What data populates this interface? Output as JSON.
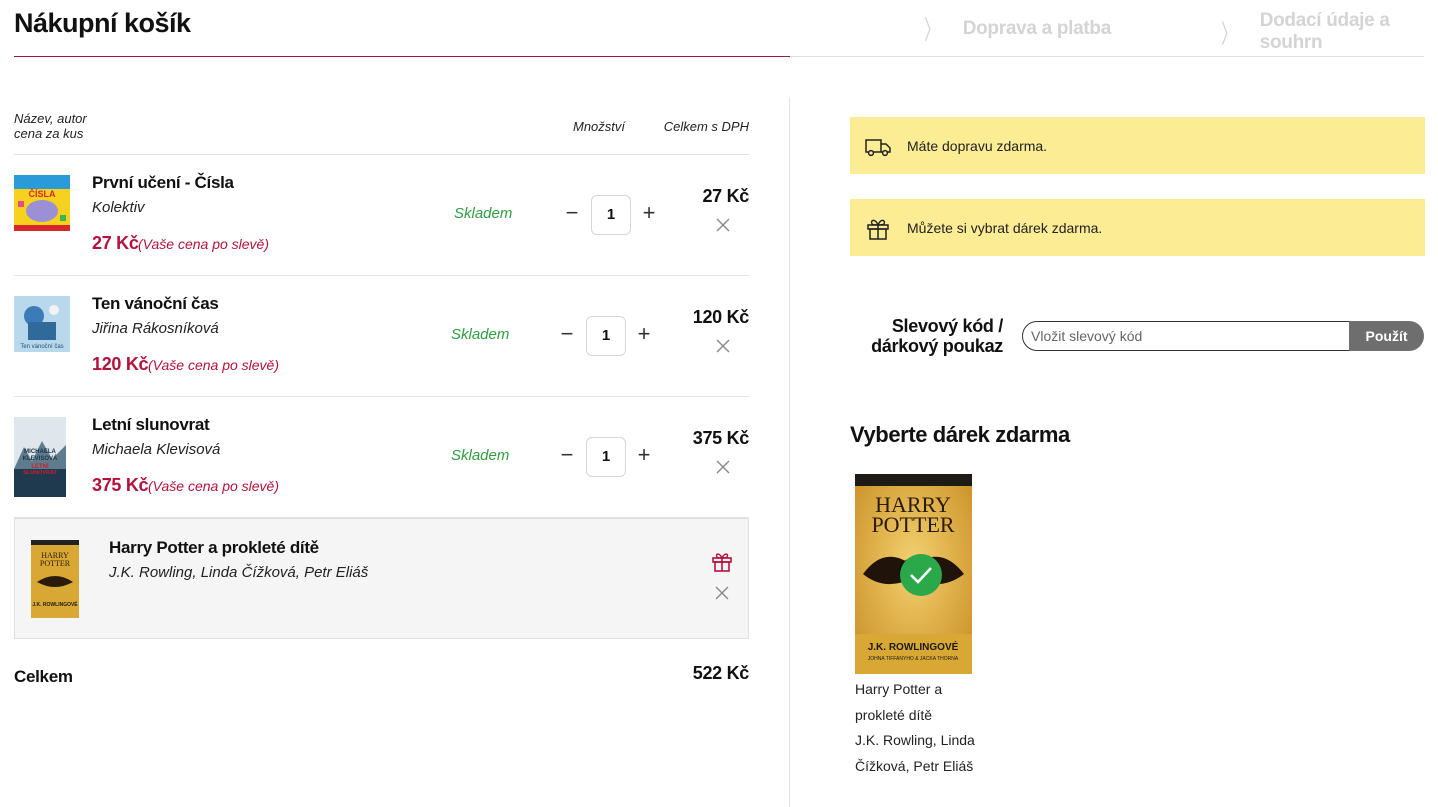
{
  "header": {
    "title": "Nákupní košík",
    "steps": [
      "Doprava a platba",
      "Dodací údaje a souhrn"
    ]
  },
  "cart": {
    "col_name": "Název, autor",
    "col_unit": "cena za kus",
    "col_qty": "Množství",
    "col_total": "Celkem s DPH",
    "items": [
      {
        "title": "První učení - Čísla",
        "author": "Kolektiv",
        "price": "27 Kč",
        "price_note": "(Vaše cena po slevě)",
        "stock": "Skladem",
        "qty": "1",
        "total": "27 Kč"
      },
      {
        "title": "Ten vánoční čas",
        "author": "Jiřina Rákosníková",
        "price": "120 Kč",
        "price_note": "(Vaše cena po slevě)",
        "stock": "Skladem",
        "qty": "1",
        "total": "120 Kč"
      },
      {
        "title": "Letní slunovrat",
        "author": "Michaela Klevisová",
        "price": "375 Kč",
        "price_note": "(Vaše cena po slevě)",
        "stock": "Skladem",
        "qty": "1",
        "total": "375 Kč"
      }
    ],
    "gift": {
      "title": "Harry Potter a prokleté dítě",
      "author": "J.K. Rowling, Linda Čížková, Petr Eliáš"
    },
    "total_label": "Celkem",
    "total_value": "522 Kč"
  },
  "notices": {
    "shipping": "Máte dopravu zdarma.",
    "gift": "Můžete si vybrat dárek zdarma."
  },
  "coupon": {
    "label_line1": "Slevový kód /",
    "label_line2": "dárkový poukaz",
    "placeholder": "Vložit slevový kód",
    "button": "Použít"
  },
  "gift_picker": {
    "heading": "Vyberte dárek zdarma",
    "option_title": "Harry Potter a prokleté dítě",
    "option_author": "J.K. Rowling, Linda Čížková, Petr Eliáš"
  },
  "colors": {
    "accent": "#b3123d",
    "stock": "#2f9e3f",
    "notice_bg": "#fcec94",
    "selected": "#2aa84a"
  }
}
